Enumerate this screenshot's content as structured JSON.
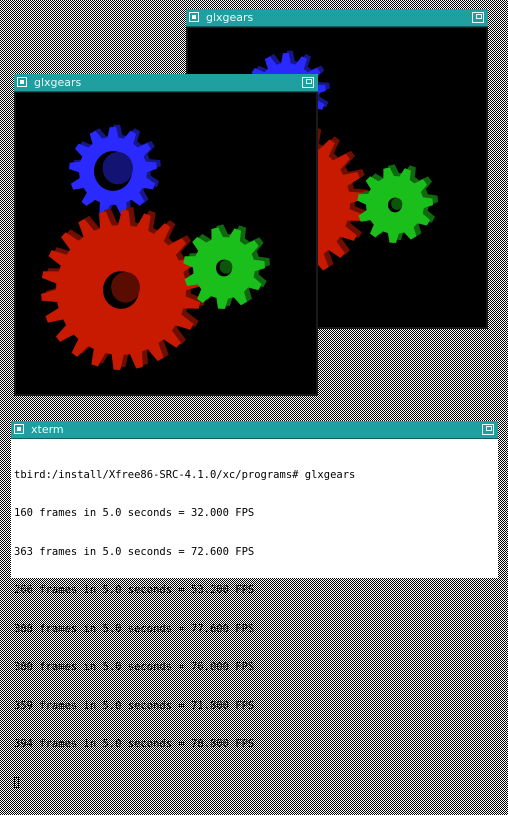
{
  "windows": {
    "gears_back": {
      "title": "glxgears"
    },
    "gears_front": {
      "title": "glxgears"
    },
    "xterm": {
      "title": "xterm",
      "lines": [
        "tbird:/install/Xfree86-SRC-4.1.0/xc/programs# glxgears",
        "160 frames in 5.0 seconds = 32.000 FPS",
        "363 frames in 5.0 seconds = 72.600 FPS",
        "266 frames in 5.0 seconds = 53.200 FPS",
        "388 frames in 5.0 seconds = 77.600 FPS",
        "380 frames in 5.0 seconds = 76.000 FPS",
        "359 frames in 5.0 seconds = 71.800 FPS",
        "394 frames in 5.0 seconds = 78.800 FPS"
      ]
    }
  },
  "colors": {
    "titlebar": "#1f9f9f",
    "gear_red": "#c81a00",
    "gear_green": "#1bbf1b",
    "gear_blue": "#2a2aff"
  }
}
